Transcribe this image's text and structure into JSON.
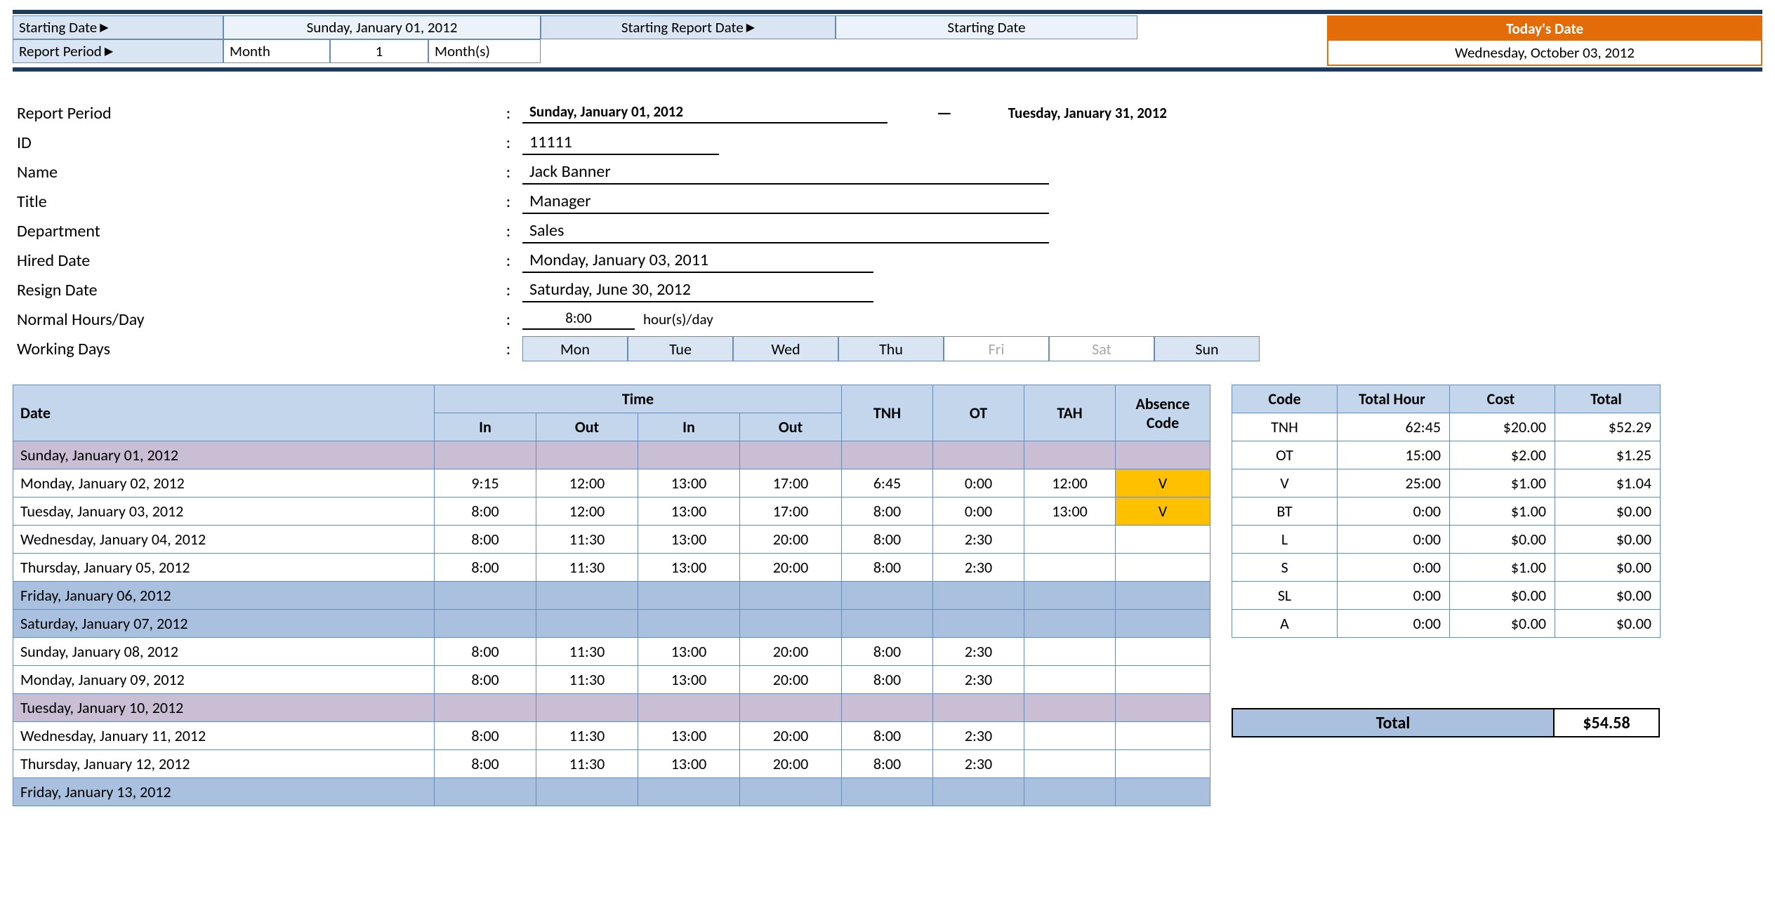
{
  "top": {
    "starting_date_label": "Starting Date",
    "starting_date_value": "Sunday, January 01, 2012",
    "report_period_label": "Report Period",
    "report_period_unit": "Month",
    "report_period_qty": "1",
    "report_period_plural": "Month(s)",
    "starting_report_date_label": "Starting Report Date",
    "starting_report_date_value": "Starting Date",
    "todays_date_label": "Today's Date",
    "todays_date_value": "Wednesday, October 03, 2012"
  },
  "info": {
    "report_period_label": "Report Period",
    "report_period_from": "Sunday, January 01, 2012",
    "report_period_to": "Tuesday, January 31, 2012",
    "id_label": "ID",
    "id_value": "11111",
    "name_label": "Name",
    "name_value": "Jack Banner",
    "title_label": "Title",
    "title_value": "Manager",
    "dept_label": "Department",
    "dept_value": "Sales",
    "hired_label": "Hired Date",
    "hired_value": "Monday, January 03, 2011",
    "resign_label": "Resign Date",
    "resign_value": "Saturday, June 30, 2012",
    "hours_label": "Normal Hours/Day",
    "hours_value": "8:00",
    "hours_unit": "hour(s)/day",
    "working_days_label": "Working Days",
    "days": [
      "Mon",
      "Tue",
      "Wed",
      "Thu",
      "Fri",
      "Sat",
      "Sun"
    ],
    "days_active": [
      true,
      true,
      true,
      true,
      false,
      false,
      true
    ]
  },
  "table": {
    "headers": {
      "date": "Date",
      "time": "Time",
      "in": "In",
      "out": "Out",
      "tnh": "TNH",
      "ot": "OT",
      "tah": "TAH",
      "abs": "Absence Code"
    },
    "rows": [
      {
        "date": "Sunday, January 01, 2012",
        "style": "purple"
      },
      {
        "date": "Monday, January 02, 2012",
        "in1": "9:15",
        "out1": "12:00",
        "in2": "13:00",
        "out2": "17:00",
        "tnh": "6:45",
        "ot": "0:00",
        "tah": "12:00",
        "abs": "V"
      },
      {
        "date": "Tuesday, January 03, 2012",
        "in1": "8:00",
        "out1": "12:00",
        "in2": "13:00",
        "out2": "17:00",
        "tnh": "8:00",
        "ot": "0:00",
        "tah": "13:00",
        "abs": "V"
      },
      {
        "date": "Wednesday, January 04, 2012",
        "in1": "8:00",
        "out1": "11:30",
        "in2": "13:00",
        "out2": "20:00",
        "tnh": "8:00",
        "ot": "2:30"
      },
      {
        "date": "Thursday, January 05, 2012",
        "in1": "8:00",
        "out1": "11:30",
        "in2": "13:00",
        "out2": "20:00",
        "tnh": "8:00",
        "ot": "2:30"
      },
      {
        "date": "Friday, January 06, 2012",
        "style": "blue"
      },
      {
        "date": "Saturday, January 07, 2012",
        "style": "blue"
      },
      {
        "date": "Sunday, January 08, 2012",
        "in1": "8:00",
        "out1": "11:30",
        "in2": "13:00",
        "out2": "20:00",
        "tnh": "8:00",
        "ot": "2:30"
      },
      {
        "date": "Monday, January 09, 2012",
        "in1": "8:00",
        "out1": "11:30",
        "in2": "13:00",
        "out2": "20:00",
        "tnh": "8:00",
        "ot": "2:30"
      },
      {
        "date": "Tuesday, January 10, 2012",
        "style": "purple"
      },
      {
        "date": "Wednesday, January 11, 2012",
        "in1": "8:00",
        "out1": "11:30",
        "in2": "13:00",
        "out2": "20:00",
        "tnh": "8:00",
        "ot": "2:30"
      },
      {
        "date": "Thursday, January 12, 2012",
        "in1": "8:00",
        "out1": "11:30",
        "in2": "13:00",
        "out2": "20:00",
        "tnh": "8:00",
        "ot": "2:30"
      },
      {
        "date": "Friday, January 13, 2012",
        "style": "blue"
      }
    ]
  },
  "summary": {
    "headers": {
      "code": "Code",
      "total_hour": "Total Hour",
      "cost": "Cost",
      "total": "Total"
    },
    "rows": [
      {
        "code": "TNH",
        "hour": "62:45",
        "cost": "$20.00",
        "total": "$52.29"
      },
      {
        "code": "OT",
        "hour": "15:00",
        "cost": "$2.00",
        "total": "$1.25"
      },
      {
        "code": "V",
        "hour": "25:00",
        "cost": "$1.00",
        "total": "$1.04"
      },
      {
        "code": "BT",
        "hour": "0:00",
        "cost": "$1.00",
        "total": "$0.00"
      },
      {
        "code": "L",
        "hour": "0:00",
        "cost": "$0.00",
        "total": "$0.00"
      },
      {
        "code": "S",
        "hour": "0:00",
        "cost": "$1.00",
        "total": "$0.00"
      },
      {
        "code": "SL",
        "hour": "0:00",
        "cost": "$0.00",
        "total": "$0.00"
      },
      {
        "code": "A",
        "hour": "0:00",
        "cost": "$0.00",
        "total": "$0.00"
      }
    ]
  },
  "grand": {
    "label": "Total",
    "value": "$54.58"
  }
}
